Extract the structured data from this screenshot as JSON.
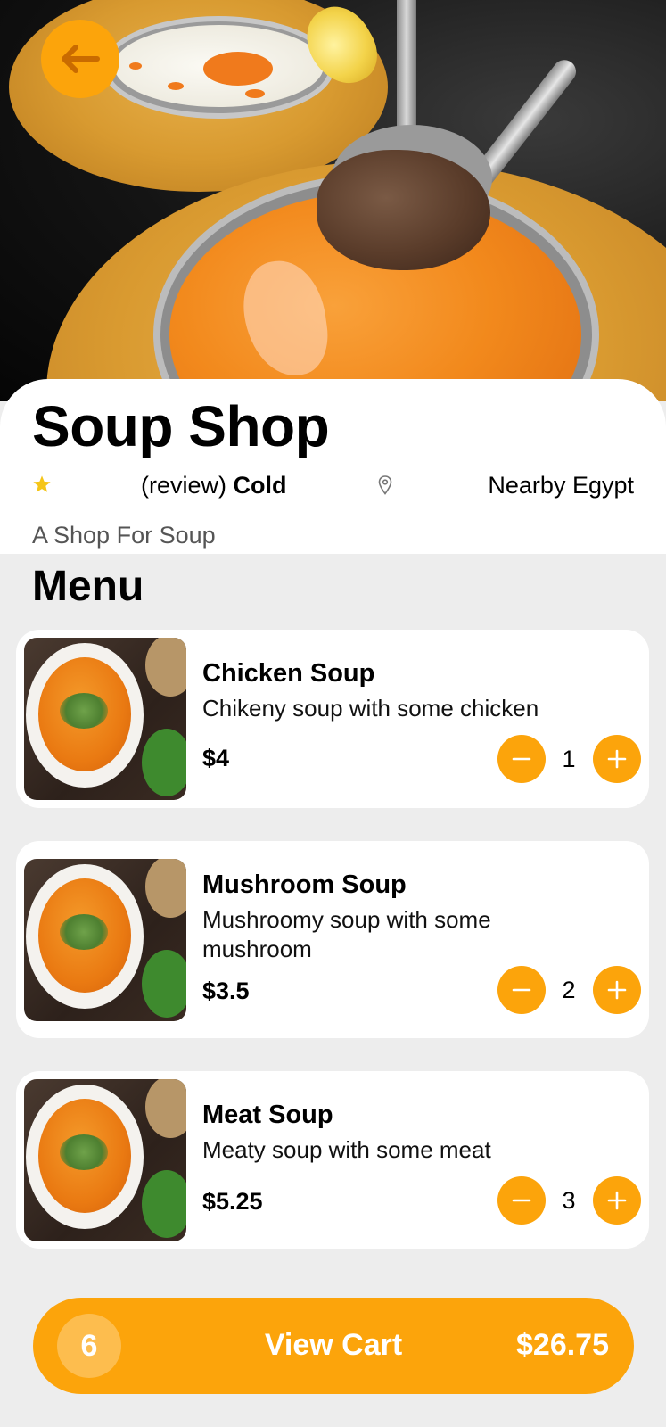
{
  "shop": {
    "name": "Soup Shop",
    "review": "(review)",
    "temperature": "Cold",
    "location": "Nearby Egypt",
    "description": "A Shop For Soup"
  },
  "icons": {
    "back": "arrow-left-icon",
    "rating": "star-icon",
    "location": "map-pin-icon",
    "decrease": "minus-icon",
    "increase": "plus-icon"
  },
  "colors": {
    "accent": "#fca40b",
    "star": "#f5c518",
    "background": "#ededed",
    "card": "#ffffff"
  },
  "menu": {
    "heading": "Menu",
    "items": [
      {
        "name": "Chicken Soup",
        "description": "Chikeny soup with some chicken",
        "price": "$4",
        "quantity": "1"
      },
      {
        "name": "Mushroom Soup",
        "description": "Mushroomy soup with some mushroom",
        "price": "$3.5",
        "quantity": "2"
      },
      {
        "name": "Meat Soup",
        "description": "Meaty soup with some meat",
        "price": "$5.25",
        "quantity": "3"
      }
    ]
  },
  "cart": {
    "count": "6",
    "label": "View Cart",
    "total": "$26.75"
  }
}
